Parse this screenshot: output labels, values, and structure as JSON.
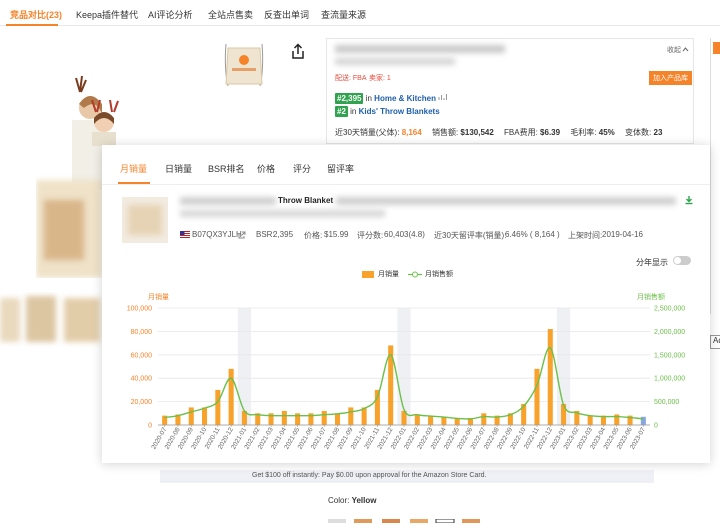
{
  "topnav": {
    "tabs": [
      {
        "label": "竞品对比(23)"
      },
      {
        "label": "Keepa插件替代"
      },
      {
        "label": "AI评论分析"
      },
      {
        "label": "全站点售卖"
      },
      {
        "label": "反查出单词"
      },
      {
        "label": "查流量来源"
      }
    ]
  },
  "product_panel": {
    "collapse_label": "收起",
    "fba_label": "配送: FBA",
    "seller_label": "卖家: 1",
    "add_button": "加入产品库",
    "rank1_tag": "#2,395",
    "rank1_in": "in",
    "rank1_category": "Home & Kitchen",
    "rank2_tag": "#2",
    "rank2_in": "in",
    "rank2_category": "Kids' Throw Blankets",
    "sales_label": "近30天销量(父体):",
    "sales_value": "8,164",
    "revenue_label": "销售额:",
    "revenue_value": "$130,542",
    "fba_fee_label": "FBA费用:",
    "fba_fee_value": "$6.39",
    "margin_label": "毛利率:",
    "margin_value": "45%",
    "variants_label": "变体数:",
    "variants_value": "23"
  },
  "page": {
    "promo_text": "Get $100 off instantly: Pay $0.00 upon approval for the Amazon Store Card.",
    "color_label": "Color:",
    "color_value": "Yellow",
    "side_button": "Ad"
  },
  "popup": {
    "tabs": [
      {
        "label": "月销量"
      },
      {
        "label": "日销量"
      },
      {
        "label": "BSR排名"
      },
      {
        "label": "价格"
      },
      {
        "label": "评分"
      },
      {
        "label": "留评率"
      }
    ],
    "product_title": "Throw Blanket",
    "asin": "B07QX3YJLH",
    "bsr_label": "BSR:",
    "bsr_value": "2,395",
    "price_label": "价格:",
    "price_value": "$15.99",
    "rating_label": "评分数:",
    "rating_value": "60,403(4.8)",
    "review_rate_label": "近30天留评率(销量):",
    "review_rate_value": "6.46% ( 8,164 )",
    "listed_label": "上架时间:",
    "listed_value": "2019-04-16",
    "year_toggle_label": "分年显示",
    "colors": {
      "accent": "#f5832a",
      "bar": "#f8a12b",
      "line": "#6cc04a",
      "rank_green": "#2fa34e",
      "link": "#1f5fae"
    }
  },
  "chart_data": {
    "type": "bar",
    "legend_position": "top-center",
    "grid": true,
    "categories": [
      "2020-07",
      "2020-08",
      "2020-09",
      "2020-10",
      "2020-11",
      "2020-12",
      "2021-01",
      "2021-02",
      "2021-03",
      "2021-04",
      "2021-05",
      "2021-06",
      "2021-07",
      "2021-08",
      "2021-09",
      "2021-10",
      "2021-11",
      "2021-12",
      "2022-01",
      "2022-02",
      "2022-03",
      "2022-04",
      "2022-05",
      "2022-06",
      "2022-07",
      "2022-08",
      "2022-09",
      "2022-10",
      "2022-11",
      "2022-12",
      "2023-01",
      "2023-02",
      "2023-03",
      "2023-04",
      "2023-05",
      "2023-06",
      "2023-07"
    ],
    "series": [
      {
        "name": "月销量",
        "axis": "left",
        "values": [
          8000,
          9000,
          15000,
          15000,
          30000,
          48000,
          12000,
          10000,
          10000,
          12000,
          10000,
          10000,
          12000,
          10000,
          15000,
          15000,
          30000,
          68000,
          12000,
          9000,
          8000,
          7000,
          6000,
          6000,
          10000,
          8000,
          10000,
          18000,
          48000,
          82000,
          18000,
          12000,
          8000,
          8000,
          9000,
          8000,
          7000
        ]
      },
      {
        "name": "月销售额",
        "axis": "right",
        "values": [
          160000,
          200000,
          280000,
          360000,
          500000,
          1000000,
          300000,
          220000,
          200000,
          200000,
          200000,
          200000,
          220000,
          240000,
          280000,
          350000,
          600000,
          1500000,
          330000,
          220000,
          190000,
          170000,
          140000,
          130000,
          180000,
          170000,
          220000,
          400000,
          850000,
          1650000,
          430000,
          260000,
          200000,
          180000,
          180000,
          160000,
          130000
        ]
      }
    ],
    "ylabel": "月销量",
    "ylabel_right": "月销售额",
    "ylim": [
      0,
      100000
    ],
    "ylim_right": [
      0,
      2500000
    ],
    "yticks": [
      "100,000",
      "80,000",
      "60,000",
      "40,000",
      "20,000",
      "0"
    ],
    "yticks_right": [
      "2,500,000",
      "2,000,000",
      "1,500,000",
      "1,000,000",
      "500,000",
      "0"
    ]
  }
}
